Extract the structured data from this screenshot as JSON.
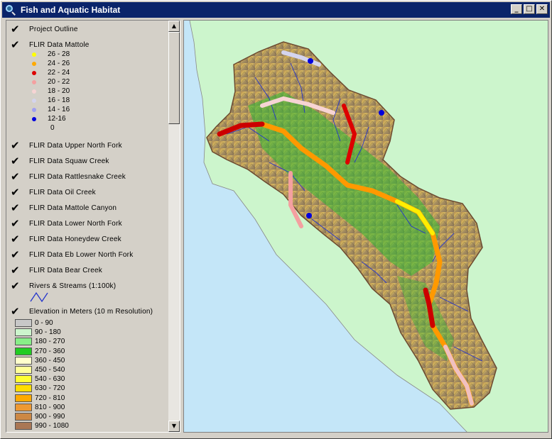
{
  "window": {
    "title": "Fish and Aquatic Habitat",
    "min": "_",
    "max": "□",
    "close": "✕"
  },
  "toc": {
    "check": "✔",
    "project_outline": "Project Outline",
    "flir_mattole": {
      "label": "FLIR Data Mattole",
      "classes": [
        {
          "label": "26 - 28",
          "color": "#ffff00"
        },
        {
          "label": "24 - 26",
          "color": "#ffaa00"
        },
        {
          "label": "22 - 24",
          "color": "#dd0000"
        },
        {
          "label": "20 - 22",
          "color": "#f4a0a0"
        },
        {
          "label": "18 - 20",
          "color": "#f7d4d4"
        },
        {
          "label": "16 - 18",
          "color": "#d4d4ee"
        },
        {
          "label": "14 - 16",
          "color": "#a0a0f0"
        },
        {
          "label": "12-16",
          "color": "#0000dd"
        },
        {
          "label": "0",
          "color": ""
        }
      ]
    },
    "layers": [
      "FLIR Data Upper North Fork",
      "FLIR Data Squaw Creek",
      "FLIR Data Rattlesnake Creek",
      "FLIR Data Oil Creek",
      "FLIR Data Mattole Canyon",
      "FLIR Data Lower North Fork",
      "FLIR Data Honeydew Creek",
      "FLIR Data Eb Lower North Fork",
      "FLIR Data Bear Creek"
    ],
    "rivers": "Rivers & Streams (1:100k)",
    "elevation": {
      "label": "Elevation in Meters (10 m Resolution)",
      "classes": [
        {
          "label": "0 - 90",
          "color": "#c8c8c8"
        },
        {
          "label": "90 - 180",
          "color": "#ccf5cc"
        },
        {
          "label": "180 - 270",
          "color": "#88ee88"
        },
        {
          "label": "270 - 360",
          "color": "#22cc22"
        },
        {
          "label": "360 - 450",
          "color": "#ffffcc"
        },
        {
          "label": "450 - 540",
          "color": "#ffff99"
        },
        {
          "label": "540 - 630",
          "color": "#ffff33"
        },
        {
          "label": "630 - 720",
          "color": "#ffdd00"
        },
        {
          "label": "720 - 810",
          "color": "#ffaa00"
        },
        {
          "label": "810 - 900",
          "color": "#ee9933"
        },
        {
          "label": "900 - 990",
          "color": "#cc8844"
        },
        {
          "label": "990 - 1080",
          "color": "#aa7755"
        }
      ]
    }
  },
  "scroll": {
    "up": "▲",
    "down": "▼"
  }
}
